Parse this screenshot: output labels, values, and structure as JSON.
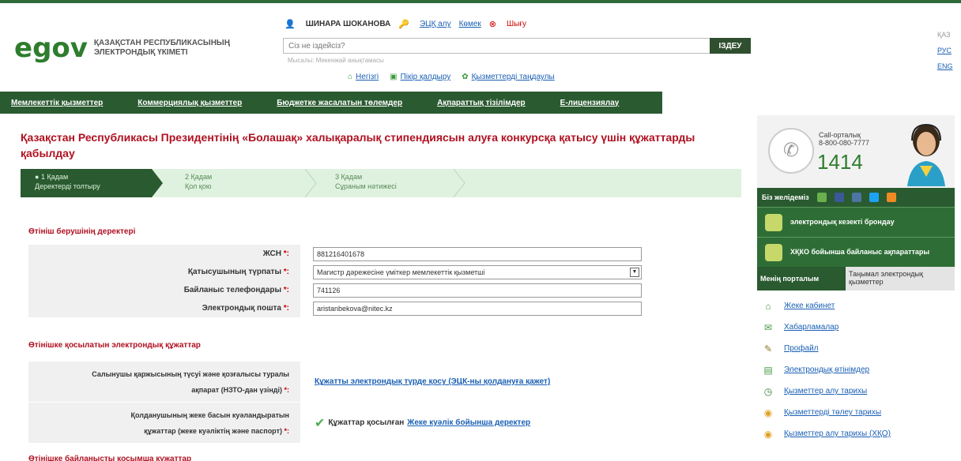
{
  "header": {
    "logo_e": "e",
    "logo_gov": "gov",
    "logo_line1": "ҚАЗАҚСТАН РЕСПУБЛИКАСЫНЫҢ",
    "logo_line2": "ЭЛЕКТРОНДЫҚ ҮКІМЕТІ",
    "user_name": "ШИНАРА ШОКАНОВА",
    "user_links": [
      "ЭЦҚ алу",
      "Көмек",
      "Шығу"
    ],
    "search_placeholder": "Сіз не іздейсіз?",
    "search_example": "Мысалы: Мекенжай анықтамасы",
    "search_button": "ІЗДЕУ",
    "quick_links": [
      "Негізгі",
      "Пікір қалдыру",
      "Қызметтерді таңдаулы"
    ],
    "languages": [
      "ҚАЗ",
      "РУС",
      "ENG"
    ]
  },
  "nav": {
    "items": [
      "Мемлекеттік қызметтер",
      "Коммерциялық қызметтер",
      "Бюджетке жасалатын төлемдер",
      "Ақпараттық тізілімдер",
      "Е-лицензиялау"
    ]
  },
  "main": {
    "title": "Қазақстан Республикасы Президентінің «Болашақ» халықаралық стипендиясын алуға конкурсқа қатысу үшін құжаттарды қабылдау",
    "steps": [
      {
        "label": "1 Қадам",
        "desc": "Деректерді толтыру"
      },
      {
        "label": "2 Қадам",
        "desc": "Қол қою"
      },
      {
        "label": "3 Қадам",
        "desc": "Сұраным нәтижесі"
      }
    ],
    "applicant_section": "Өтініш берушінің деректері",
    "fields": [
      {
        "label": "ЖСН",
        "value": "881216401678"
      },
      {
        "label": "Қатысушының түрпаты",
        "value": "Магистр дәрежесіне үміткер мемлекеттік қызметші"
      },
      {
        "label": "Байланыс телефондары",
        "value": "741126"
      },
      {
        "label": "Электрондық пошта",
        "value": "aristanbekova@nitec.kz"
      }
    ],
    "required_mark": "*:",
    "attached_section": "Өтінішке қосылатын электрондық құжаттар",
    "docs": [
      {
        "label_line1": "Салынушы қаржысының түсуі және қозғалысы туралы",
        "label_line2": "ақпарат (НЗТО-дан үзінді)",
        "link": "Құжатты электрондық түрде қосу (ЭЦК-ны қолдануға қажет)"
      },
      {
        "label_line1": "Қолданушының жеке басын куәландыратын",
        "label_line2": "құжаттар (жеке куәліктің және паспорт)",
        "status": "Құжаттар қосылған",
        "link": "Жеке куәлік бойынша деректер"
      }
    ],
    "additional_section": "Өтінішке байланысты қосымша құжаттар"
  },
  "sidebar": {
    "call_label_line1": "Call-орталық",
    "call_label_line2": "8-800-080-7777",
    "call_number": "1414",
    "social_label": "Біз желідеміз",
    "buttons": [
      "электрондық кезекті брондау",
      "ХҚКО бойынша байланыс ақпараттары"
    ],
    "tab_active": "Менің порталым",
    "tab_inactive": "Таңымал электрондық қызметтер",
    "menu": [
      "Жеке кабинет",
      "Хабарламалар",
      "Профайл",
      "Электрондық өтінімдер",
      "Қызметтер алу тарихы",
      "Қызметтерді төлеу тарихы",
      "Қызметтер алу тарихы (ХҚО)"
    ]
  },
  "colors": {
    "brand_green": "#2a5a30",
    "title_red": "#b01020",
    "link_blue": "#1a5fb4"
  }
}
